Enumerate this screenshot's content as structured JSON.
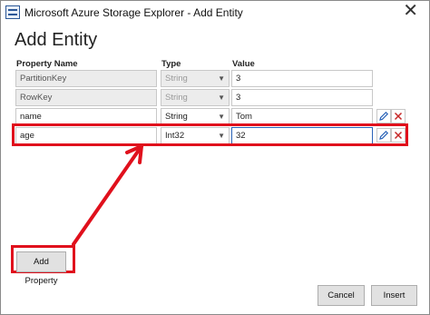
{
  "window": {
    "title": "Microsoft Azure Storage Explorer - Add Entity"
  },
  "dialog": {
    "heading": "Add Entity"
  },
  "columns": {
    "property_name": "Property Name",
    "type": "Type",
    "value": "Value"
  },
  "rows": [
    {
      "name": "PartitionKey",
      "type": "String",
      "value": "3",
      "editable": false
    },
    {
      "name": "RowKey",
      "type": "String",
      "value": "3",
      "editable": false
    },
    {
      "name": "name",
      "type": "String",
      "value": "Tom",
      "editable": true
    },
    {
      "name": "age",
      "type": "Int32",
      "value": "32",
      "editable": true
    }
  ],
  "buttons": {
    "add_property": "Add Property",
    "cancel": "Cancel",
    "insert": "Insert"
  },
  "icons": {
    "close": "close-icon",
    "edit": "pencil-icon",
    "delete": "delete-x-icon",
    "dropdown": "chevron-down-icon",
    "app": "storage-explorer-app-icon"
  },
  "colors": {
    "annotation": "#e0101c",
    "focus_border": "#2a63b8",
    "edit_icon": "#2a63b8",
    "delete_icon": "#c62828",
    "readonly_bg": "#ececec"
  }
}
